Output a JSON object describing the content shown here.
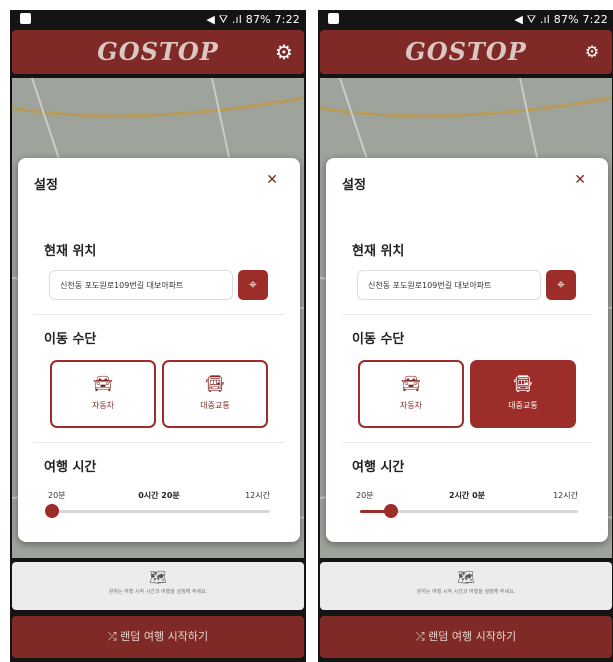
{
  "status_bar": {
    "right_text": "◀︎ ⛛ .ıl 87% 7:22"
  },
  "app": {
    "logo": "GOSTOP",
    "gear_icon": "gear-icon"
  },
  "dialog": {
    "title": "설정",
    "close_label": "✕",
    "location_section": "현재 위치",
    "location_value": "신천동 포도원로109번길 대보아파트",
    "transport_section": "이동 수단",
    "car_label": "자동차",
    "transit_label": "대중교통",
    "travel_section": "여행 시간",
    "slider_min": "20분",
    "slider_max": "12시간"
  },
  "screens": [
    {
      "selected_mode": "car",
      "travel_time_value": "0시간 20분",
      "slider_fraction": 0.0
    },
    {
      "selected_mode": "transit",
      "travel_time_value": "2시간 0분",
      "slider_fraction": 0.14
    }
  ],
  "bottom_card": {
    "text": "원하는 여행 시작 시간과 여행을 설정해 주세요."
  },
  "start_button": {
    "label": "⤮ 랜덤 여행 시작하기"
  },
  "colors": {
    "brand": "#7f2a26",
    "accent": "#9c2d28"
  }
}
